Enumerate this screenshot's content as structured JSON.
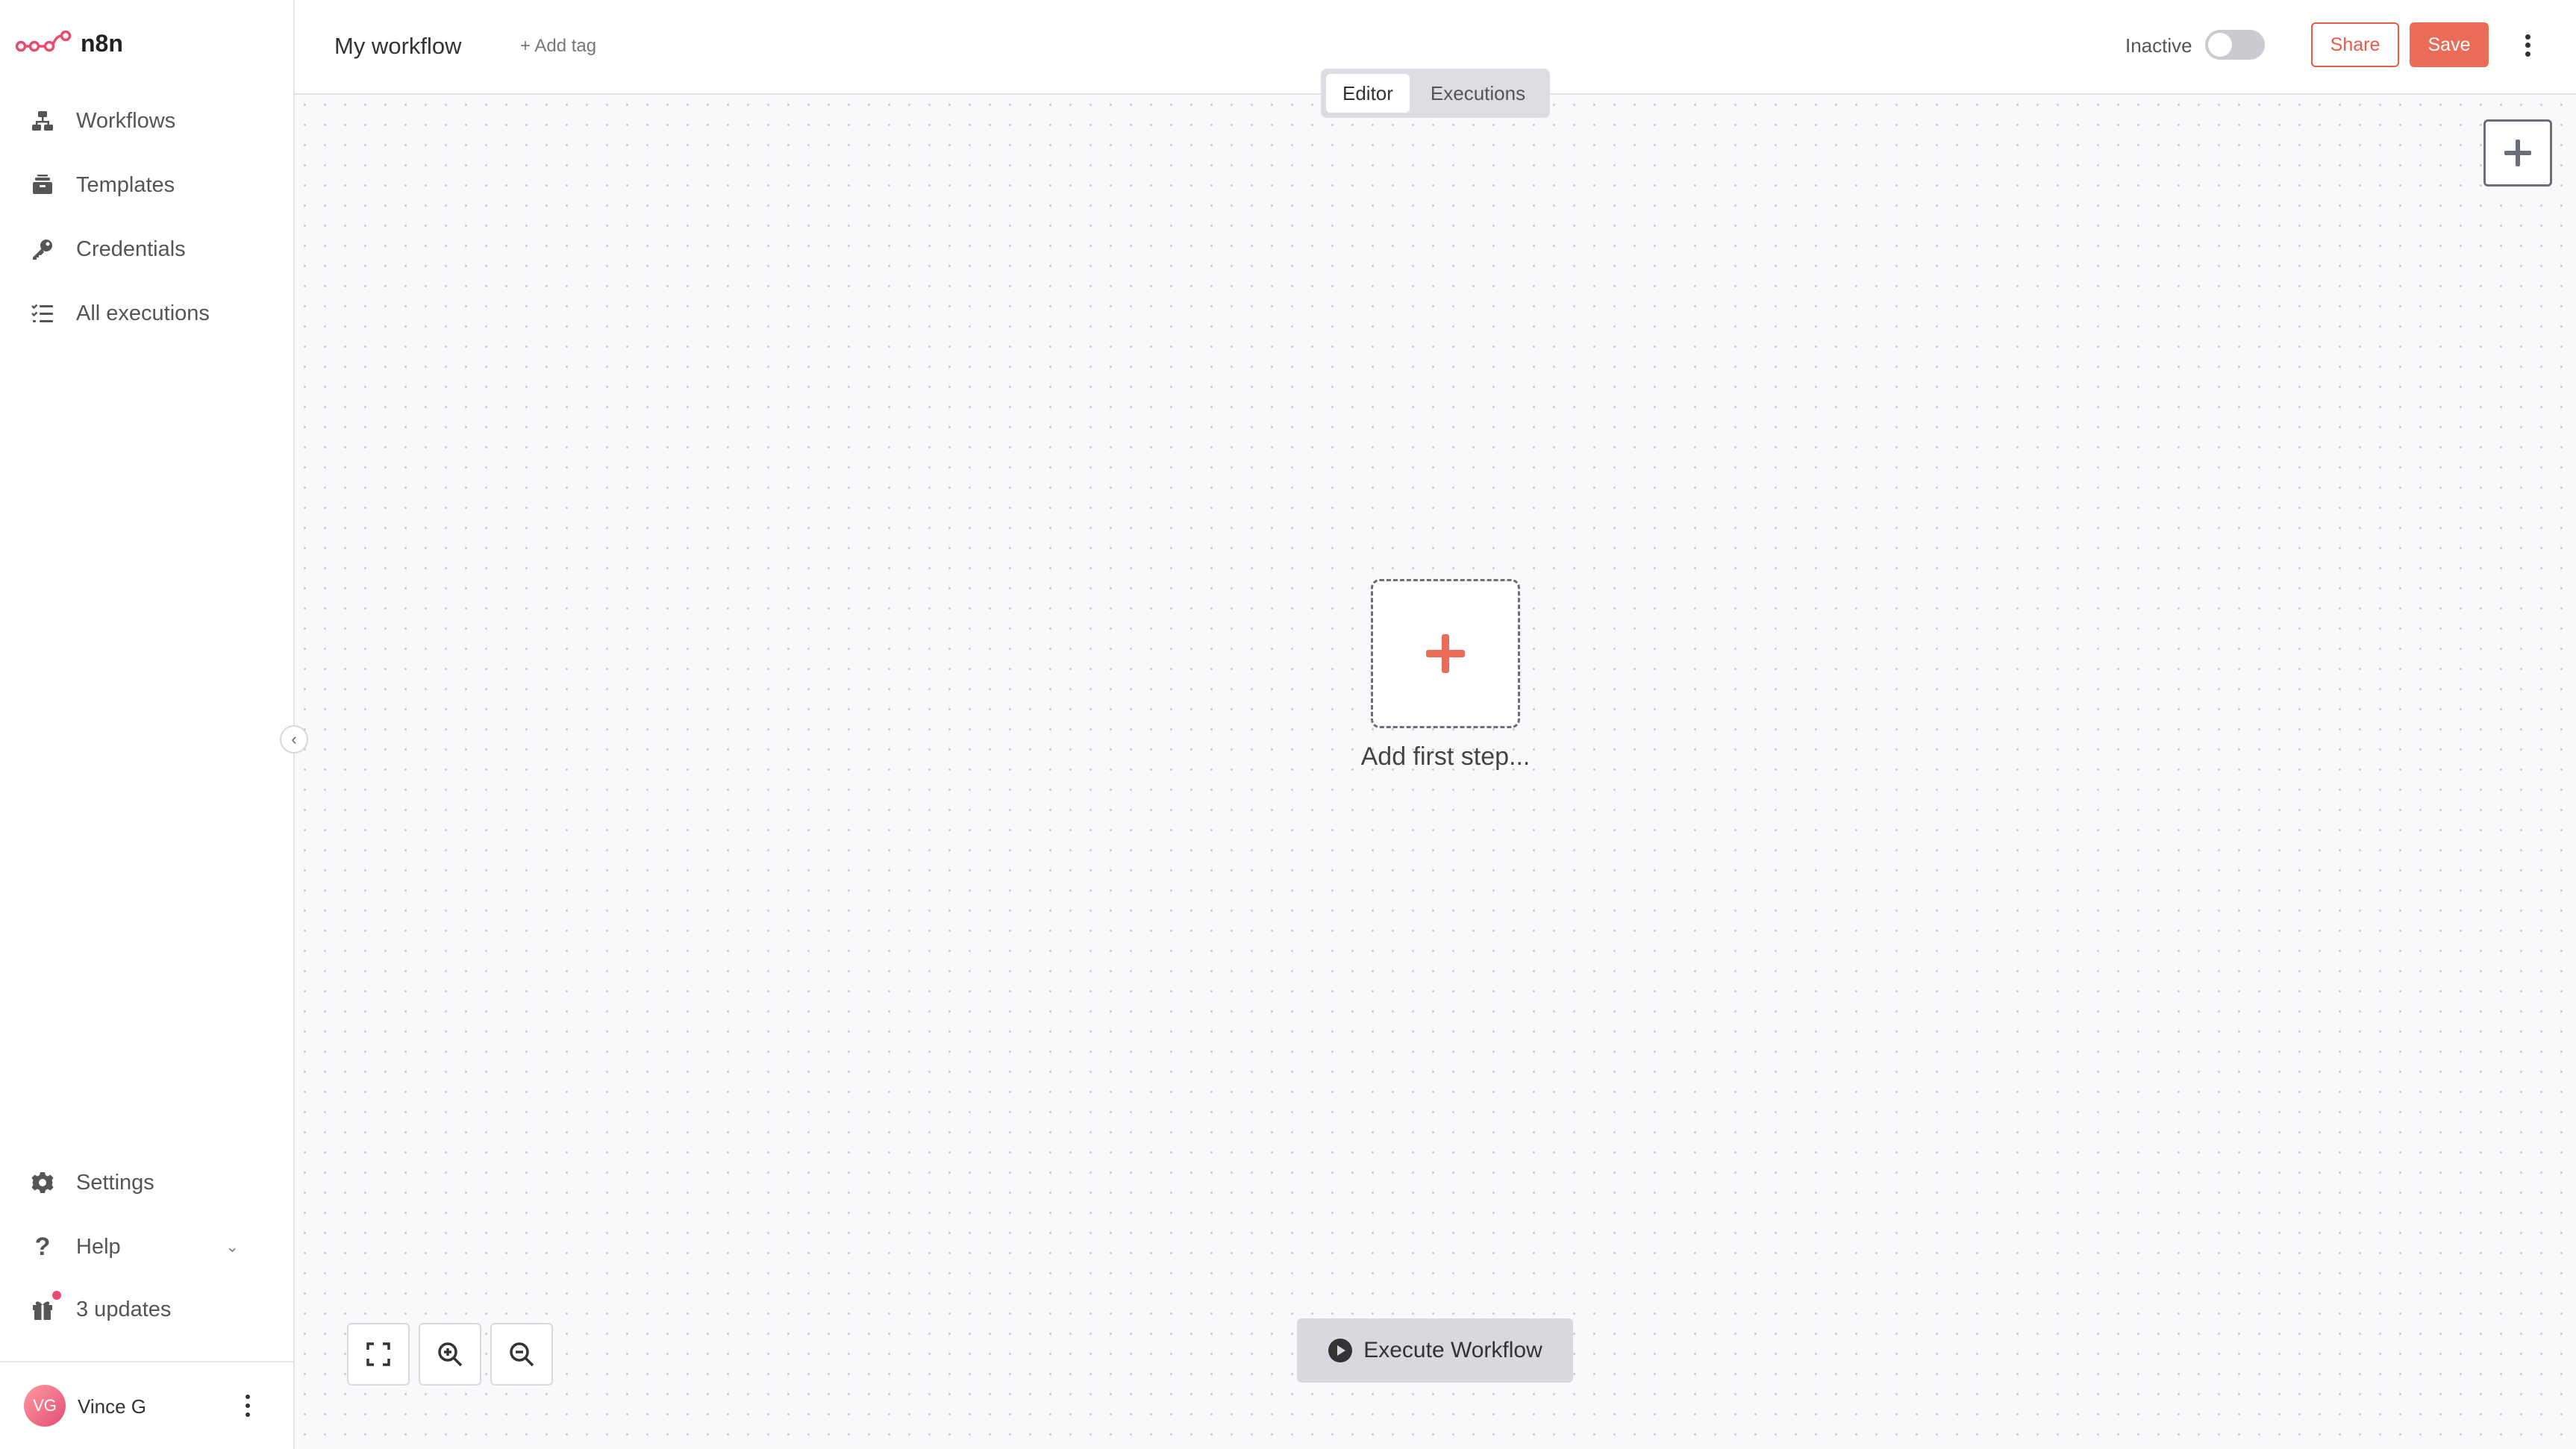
{
  "brand": {
    "name": "n8n",
    "color": "#ea4b71"
  },
  "sidebar": {
    "items": [
      {
        "label": "Workflows",
        "icon": "workflows-icon"
      },
      {
        "label": "Templates",
        "icon": "templates-icon"
      },
      {
        "label": "Credentials",
        "icon": "key-icon"
      },
      {
        "label": "All executions",
        "icon": "list-icon"
      }
    ],
    "bottom": {
      "settings": "Settings",
      "help": "Help",
      "updates": "3 updates"
    },
    "user": {
      "initials": "VG",
      "name": "Vince G"
    }
  },
  "header": {
    "workflow_name": "My workflow",
    "add_tag": "+ Add tag",
    "status_label": "Inactive",
    "active": false,
    "share_label": "Share",
    "save_label": "Save",
    "tabs": [
      {
        "label": "Editor",
        "active": true
      },
      {
        "label": "Executions",
        "active": false
      }
    ]
  },
  "canvas": {
    "add_first_step": "Add first step...",
    "execute_label": "Execute Workflow"
  },
  "colors": {
    "accent": "#ea6b58",
    "canvas_bg": "#f9f9fb"
  }
}
